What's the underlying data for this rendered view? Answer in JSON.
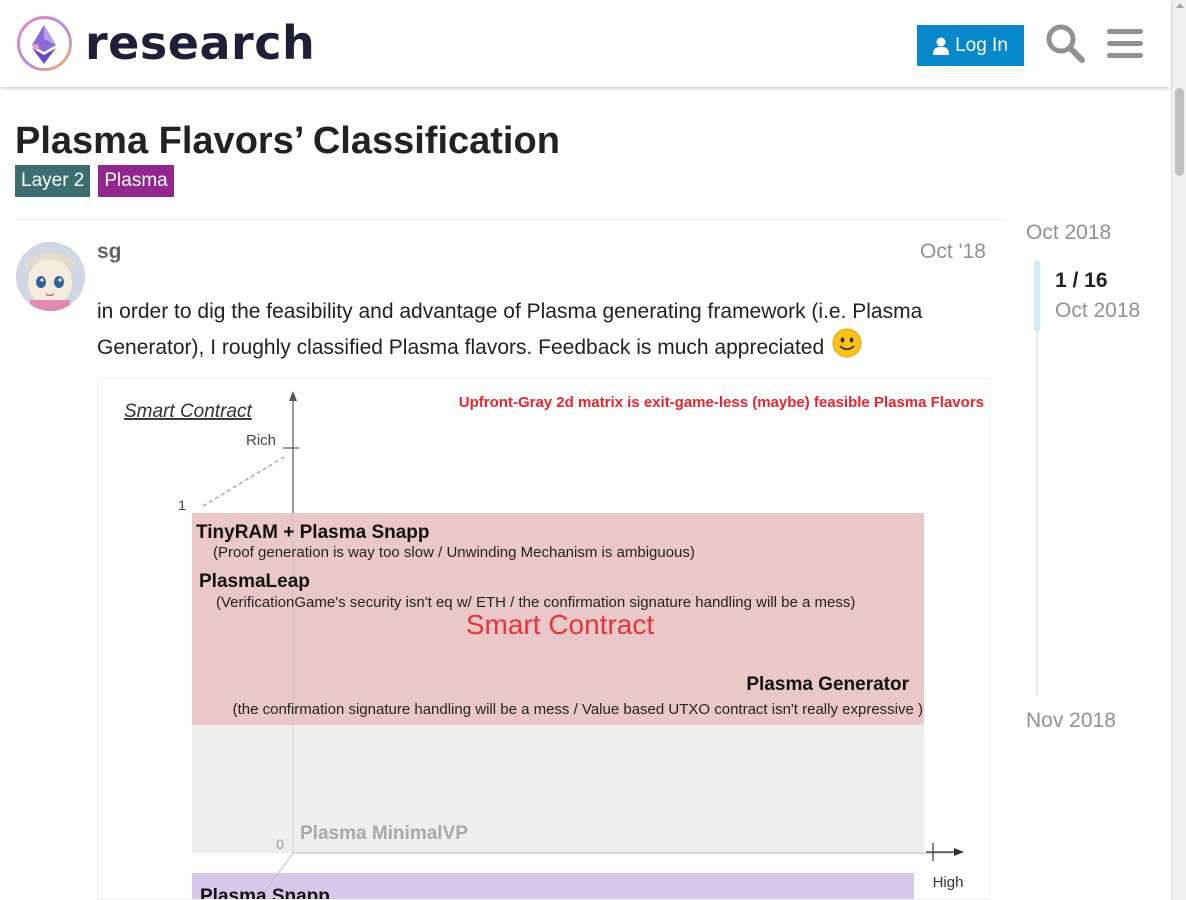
{
  "site": {
    "name": "research"
  },
  "header": {
    "login_label": "Log In"
  },
  "topic": {
    "title": "Plasma Flavors’ Classification",
    "tags": [
      {
        "label": "Layer 2",
        "color": "#3c6e71"
      },
      {
        "label": "Plasma",
        "color": "#92278f"
      }
    ]
  },
  "post": {
    "username": "sg",
    "date": "Oct '18",
    "body": "in order to dig the feasibility and advantage of Plasma generating framework (i.e. Plasma Generator), I roughly classified Plasma flavors. Feedback is much appreciated",
    "emoji": "slightly-smiling-face"
  },
  "figure": {
    "axis_label": "Smart Contract",
    "axis_rich": "Rich",
    "axis_one": "1",
    "axis_zero": "0",
    "axis_high": "High",
    "headline": "Upfront-Gray 2d matrix is  exit-game-less (maybe) feasible Plasma Flavors",
    "region_label": "Smart Contract",
    "items": [
      {
        "name": "TinyRAM + Plasma Snapp",
        "note": "(Proof generation is way too slow / Unwinding Mechanism is ambiguous)"
      },
      {
        "name": "PlasmaLeap",
        "note": "(VerificationGame's security isn't eq w/ ETH / the confirmation signature handling will be a mess)"
      },
      {
        "name": "Plasma Generator",
        "note": "(the confirmation signature handling will be a mess / Value based UTXO contract isn't really expressive )"
      },
      {
        "name": "Plasma MinimalVP",
        "note": ""
      },
      {
        "name": "Plasma Snapp",
        "note": ""
      }
    ],
    "colors": {
      "red_region": "#ebc8c8",
      "gray_region": "#efefef",
      "purple_region": "#d8c9ec",
      "headline": "#e8232a"
    }
  },
  "timeline": {
    "start": "Oct 2018",
    "position": "1 / 16",
    "current_date": "Oct 2018",
    "end": "Nov 2018"
  },
  "theme": {
    "accent": "#0688ca"
  }
}
